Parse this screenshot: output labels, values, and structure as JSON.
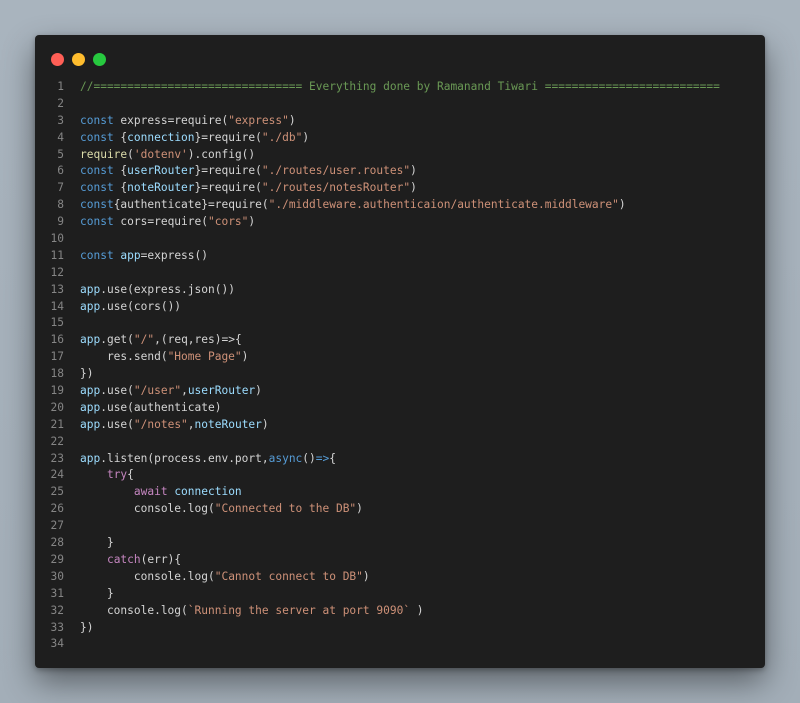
{
  "window": {
    "controls": [
      {
        "name": "close",
        "color": "#ff5f56"
      },
      {
        "name": "minimize",
        "color": "#ffbd2e"
      },
      {
        "name": "maximize",
        "color": "#27c93f"
      }
    ]
  },
  "theme": {
    "background": "#1e1e1e",
    "keyword": "#569cd6",
    "control": "#c586c0",
    "variable": "#9cdcfe",
    "function": "#dcdcaa",
    "string": "#ce9178",
    "comment": "#6a9955",
    "line_number": "#858585",
    "text": "#d4d4d4"
  },
  "code": {
    "lines": [
      {
        "n": "1",
        "tokens": [
          [
            "cm",
            "//=============================== Everything done by Ramanand Tiwari =========================="
          ]
        ]
      },
      {
        "n": "2",
        "tokens": []
      },
      {
        "n": "3",
        "tokens": [
          [
            "kw",
            "const "
          ],
          [
            "p",
            "express=require("
          ],
          [
            "str",
            "\"express\""
          ],
          [
            "p",
            ")"
          ]
        ]
      },
      {
        "n": "4",
        "tokens": [
          [
            "kw",
            "const "
          ],
          [
            "p",
            "{"
          ],
          [
            "var",
            "connection"
          ],
          [
            "p",
            "}=require("
          ],
          [
            "str",
            "\"./db\""
          ],
          [
            "p",
            ")"
          ]
        ]
      },
      {
        "n": "5",
        "tokens": [
          [
            "fn",
            "require"
          ],
          [
            "p",
            "("
          ],
          [
            "str",
            "'dotenv'"
          ],
          [
            "p",
            ").config()"
          ]
        ]
      },
      {
        "n": "6",
        "tokens": [
          [
            "kw",
            "const "
          ],
          [
            "p",
            "{"
          ],
          [
            "var",
            "userRouter"
          ],
          [
            "p",
            "}=require("
          ],
          [
            "str",
            "\"./routes/user.routes\""
          ],
          [
            "p",
            ")"
          ]
        ]
      },
      {
        "n": "7",
        "tokens": [
          [
            "kw",
            "const "
          ],
          [
            "p",
            "{"
          ],
          [
            "var",
            "noteRouter"
          ],
          [
            "p",
            "}=require("
          ],
          [
            "str",
            "\"./routes/notesRouter\""
          ],
          [
            "p",
            ")"
          ]
        ]
      },
      {
        "n": "8",
        "tokens": [
          [
            "kw",
            "const"
          ],
          [
            "p",
            "{authenticate}=require("
          ],
          [
            "str",
            "\"./middleware.authenticaion/authenticate.middleware\""
          ],
          [
            "p",
            ")"
          ]
        ]
      },
      {
        "n": "9",
        "tokens": [
          [
            "kw",
            "const "
          ],
          [
            "p",
            "cors=require("
          ],
          [
            "str",
            "\"cors\""
          ],
          [
            "p",
            ")"
          ]
        ]
      },
      {
        "n": "10",
        "tokens": []
      },
      {
        "n": "11",
        "tokens": [
          [
            "kw",
            "const "
          ],
          [
            "var",
            "app"
          ],
          [
            "p",
            "=express()"
          ]
        ]
      },
      {
        "n": "12",
        "tokens": []
      },
      {
        "n": "13",
        "tokens": [
          [
            "var",
            "app"
          ],
          [
            "p",
            ".use(express.json())"
          ]
        ]
      },
      {
        "n": "14",
        "tokens": [
          [
            "var",
            "app"
          ],
          [
            "p",
            ".use(cors())"
          ]
        ]
      },
      {
        "n": "15",
        "tokens": []
      },
      {
        "n": "16",
        "tokens": [
          [
            "var",
            "app"
          ],
          [
            "p",
            ".get("
          ],
          [
            "str",
            "\"/\""
          ],
          [
            "p",
            ",(req,res)=>{"
          ]
        ]
      },
      {
        "n": "17",
        "tokens": [
          [
            "p",
            "    res.send("
          ],
          [
            "str",
            "\"Home Page\""
          ],
          [
            "p",
            ")"
          ]
        ]
      },
      {
        "n": "18",
        "tokens": [
          [
            "p",
            "})"
          ]
        ]
      },
      {
        "n": "19",
        "tokens": [
          [
            "var",
            "app"
          ],
          [
            "p",
            ".use("
          ],
          [
            "str",
            "\"/user\""
          ],
          [
            "p",
            ","
          ],
          [
            "var",
            "userRouter"
          ],
          [
            "p",
            ")"
          ]
        ]
      },
      {
        "n": "20",
        "tokens": [
          [
            "var",
            "app"
          ],
          [
            "p",
            ".use(authenticate)"
          ]
        ]
      },
      {
        "n": "21",
        "tokens": [
          [
            "var",
            "app"
          ],
          [
            "p",
            ".use("
          ],
          [
            "str",
            "\"/notes\""
          ],
          [
            "p",
            ","
          ],
          [
            "var",
            "noteRouter"
          ],
          [
            "p",
            ")"
          ]
        ]
      },
      {
        "n": "22",
        "tokens": []
      },
      {
        "n": "23",
        "tokens": [
          [
            "var",
            "app"
          ],
          [
            "p",
            ".listen(process.env.port,"
          ],
          [
            "kw",
            "async"
          ],
          [
            "p",
            "()"
          ],
          [
            "kw",
            "=>"
          ],
          [
            "p",
            "{"
          ]
        ]
      },
      {
        "n": "24",
        "tokens": [
          [
            "p",
            "    "
          ],
          [
            "ctl",
            "try"
          ],
          [
            "p",
            "{"
          ]
        ]
      },
      {
        "n": "25",
        "tokens": [
          [
            "p",
            "        "
          ],
          [
            "ctl",
            "await "
          ],
          [
            "var",
            "connection"
          ]
        ]
      },
      {
        "n": "26",
        "tokens": [
          [
            "p",
            "        console.log("
          ],
          [
            "str",
            "\"Connected to the DB\""
          ],
          [
            "p",
            ")"
          ]
        ]
      },
      {
        "n": "27",
        "tokens": []
      },
      {
        "n": "28",
        "tokens": [
          [
            "p",
            "    }"
          ]
        ]
      },
      {
        "n": "29",
        "tokens": [
          [
            "p",
            "    "
          ],
          [
            "ctl",
            "catch"
          ],
          [
            "p",
            "(err){"
          ]
        ]
      },
      {
        "n": "30",
        "tokens": [
          [
            "p",
            "        console.log("
          ],
          [
            "str",
            "\"Cannot connect to DB\""
          ],
          [
            "p",
            ")"
          ]
        ]
      },
      {
        "n": "31",
        "tokens": [
          [
            "p",
            "    }"
          ]
        ]
      },
      {
        "n": "32",
        "tokens": [
          [
            "p",
            "    console.log("
          ],
          [
            "str",
            "`Running the server at port 9090`"
          ],
          [
            "p",
            " )"
          ]
        ]
      },
      {
        "n": "33",
        "tokens": [
          [
            "p",
            "})"
          ]
        ]
      },
      {
        "n": "34",
        "tokens": []
      }
    ]
  }
}
